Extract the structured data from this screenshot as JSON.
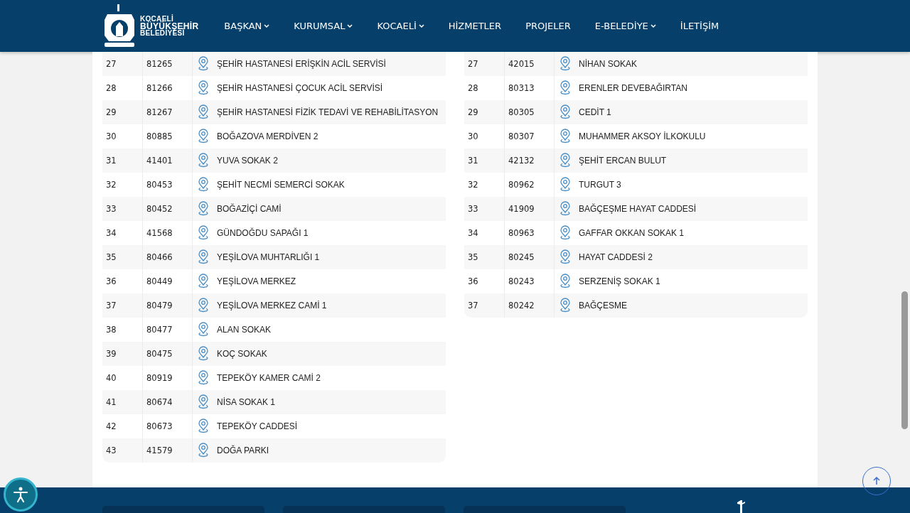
{
  "header": {
    "logo_lines": [
      "KOCAELİ",
      "BÜYÜKŞEHİR",
      "BELEDİYESİ"
    ],
    "nav": [
      {
        "label": "BAŞKAN",
        "dropdown": true
      },
      {
        "label": "KURUMSAL",
        "dropdown": true
      },
      {
        "label": "KOCAELİ",
        "dropdown": true
      },
      {
        "label": "HİZMETLER",
        "dropdown": false
      },
      {
        "label": "PROJELER",
        "dropdown": false
      },
      {
        "label": "E-BELEDİYE",
        "dropdown": true
      },
      {
        "label": "İLETİŞİM",
        "dropdown": false
      }
    ]
  },
  "tables": [
    {
      "rows": [
        [
          "27",
          "81265",
          "ŞEHİR HASTANESİ ERİŞKİN ACİL SERVİSİ"
        ],
        [
          "28",
          "81266",
          "ŞEHİR HASTANESİ ÇOCUK ACİL SERVİSİ"
        ],
        [
          "29",
          "81267",
          "ŞEHİR HASTANESİ FİZİK TEDAVİ VE REHABİLİTASYON"
        ],
        [
          "30",
          "80885",
          "BOĞAZOVA MERDİVEN 2"
        ],
        [
          "31",
          "41401",
          "YUVA SOKAK 2"
        ],
        [
          "32",
          "80453",
          "ŞEHİT NECMİ SEMERCİ SOKAK"
        ],
        [
          "33",
          "80452",
          "BOĞAZİÇİ CAMİ"
        ],
        [
          "34",
          "41568",
          "GÜNDOĞDU SAPAĞI 1"
        ],
        [
          "35",
          "80466",
          "YEŞİLOVA MUHTARLIĞI 1"
        ],
        [
          "36",
          "80449",
          "YEŞİLOVA MERKEZ"
        ],
        [
          "37",
          "80479",
          "YEŞİLOVA MERKEZ CAMİ 1"
        ],
        [
          "38",
          "80477",
          "ALAN SOKAK"
        ],
        [
          "39",
          "80475",
          "KOÇ SOKAK"
        ],
        [
          "40",
          "80919",
          "TEPEKÖY KAMER CAMİ 2"
        ],
        [
          "41",
          "80674",
          "NİSA SOKAK 1"
        ],
        [
          "42",
          "80673",
          "TEPEKÖY CADDESİ"
        ],
        [
          "43",
          "41579",
          "DOĞA PARKI"
        ]
      ]
    },
    {
      "rows": [
        [
          "27",
          "42015",
          "NİHAN SOKAK"
        ],
        [
          "28",
          "80313",
          "ERENLER DEVEBAĞIRTAN"
        ],
        [
          "29",
          "80305",
          "CEDİT 1"
        ],
        [
          "30",
          "80307",
          "MUHAMMER AKSOY İLKOKULU"
        ],
        [
          "31",
          "42132",
          "ŞEHİT ERCAN BULUT"
        ],
        [
          "32",
          "80962",
          "TURGUT 3"
        ],
        [
          "33",
          "41909",
          "BAĞÇEŞME HAYAT CADDESİ"
        ],
        [
          "34",
          "80963",
          "GAFFAR OKKAN SOKAK 1"
        ],
        [
          "35",
          "80245",
          "HAYAT CADDESİ 2"
        ],
        [
          "36",
          "80243",
          "SERZENİŞ SOKAK 1"
        ],
        [
          "37",
          "80242",
          "BAĞÇESME"
        ]
      ]
    }
  ]
}
